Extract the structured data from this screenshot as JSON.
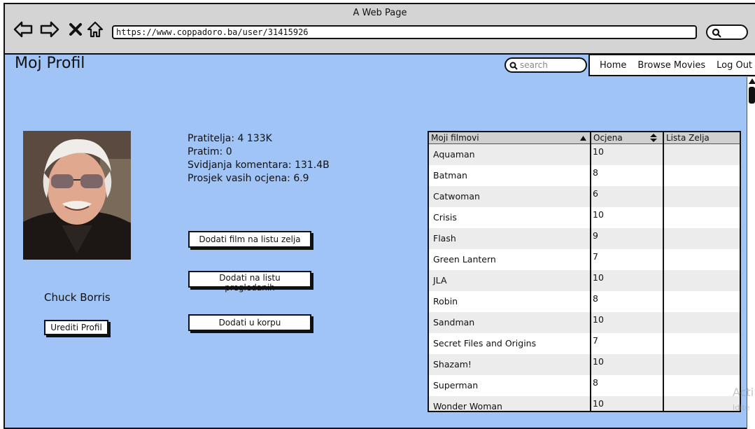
{
  "window": {
    "title": "A Web Page",
    "url": "https://www.coppadoro.ba/user/31415926"
  },
  "icons": {
    "back": "back-arrow-icon",
    "forward": "forward-arrow-icon",
    "stop": "close-icon",
    "home": "home-icon",
    "search": "search-icon"
  },
  "header": {
    "page_title": "Moj Profil",
    "search_placeholder": "search",
    "nav": [
      "Home",
      "Browse Movies",
      "Log Out"
    ]
  },
  "profile": {
    "name": "Chuck Borris",
    "edit_label": "Urediti Profil",
    "stats": [
      "Pratitelja: 4 133K",
      "Pratim: 0",
      "Svidjanja komentara: 131.4B",
      "Prosjek vasih ocjena: 6.9"
    ]
  },
  "actions": {
    "add_wishlist": "Dodati film na listu zelja",
    "add_watched": "Dodati na listu pregledanih",
    "add_cart": "Dodati u korpu"
  },
  "table": {
    "headers": [
      "Moji filmovi",
      "Ocjena",
      "Lista Zelja"
    ],
    "rows": [
      {
        "film": "Aquaman",
        "rating": "10",
        "wish": ""
      },
      {
        "film": "Batman",
        "rating": "8",
        "wish": ""
      },
      {
        "film": "Catwoman",
        "rating": "6",
        "wish": ""
      },
      {
        "film": "Crisis",
        "rating": "10",
        "wish": ""
      },
      {
        "film": "Flash",
        "rating": "9",
        "wish": ""
      },
      {
        "film": "Green Lantern",
        "rating": "7",
        "wish": ""
      },
      {
        "film": "JLA",
        "rating": "10",
        "wish": ""
      },
      {
        "film": "Robin",
        "rating": "8",
        "wish": ""
      },
      {
        "film": "Sandman",
        "rating": "10",
        "wish": ""
      },
      {
        "film": "Secret Files and Origins",
        "rating": "7",
        "wish": ""
      },
      {
        "film": "Shazam!",
        "rating": "10",
        "wish": ""
      },
      {
        "film": "Superman",
        "rating": "8",
        "wish": ""
      },
      {
        "film": "Wonder Woman",
        "rating": "10",
        "wish": ""
      }
    ]
  },
  "watermark": {
    "line1": "Acti",
    "line2": "Idite"
  },
  "colors": {
    "page_bg": "#a0c4f6",
    "chrome_bg": "#d4d4d4"
  }
}
